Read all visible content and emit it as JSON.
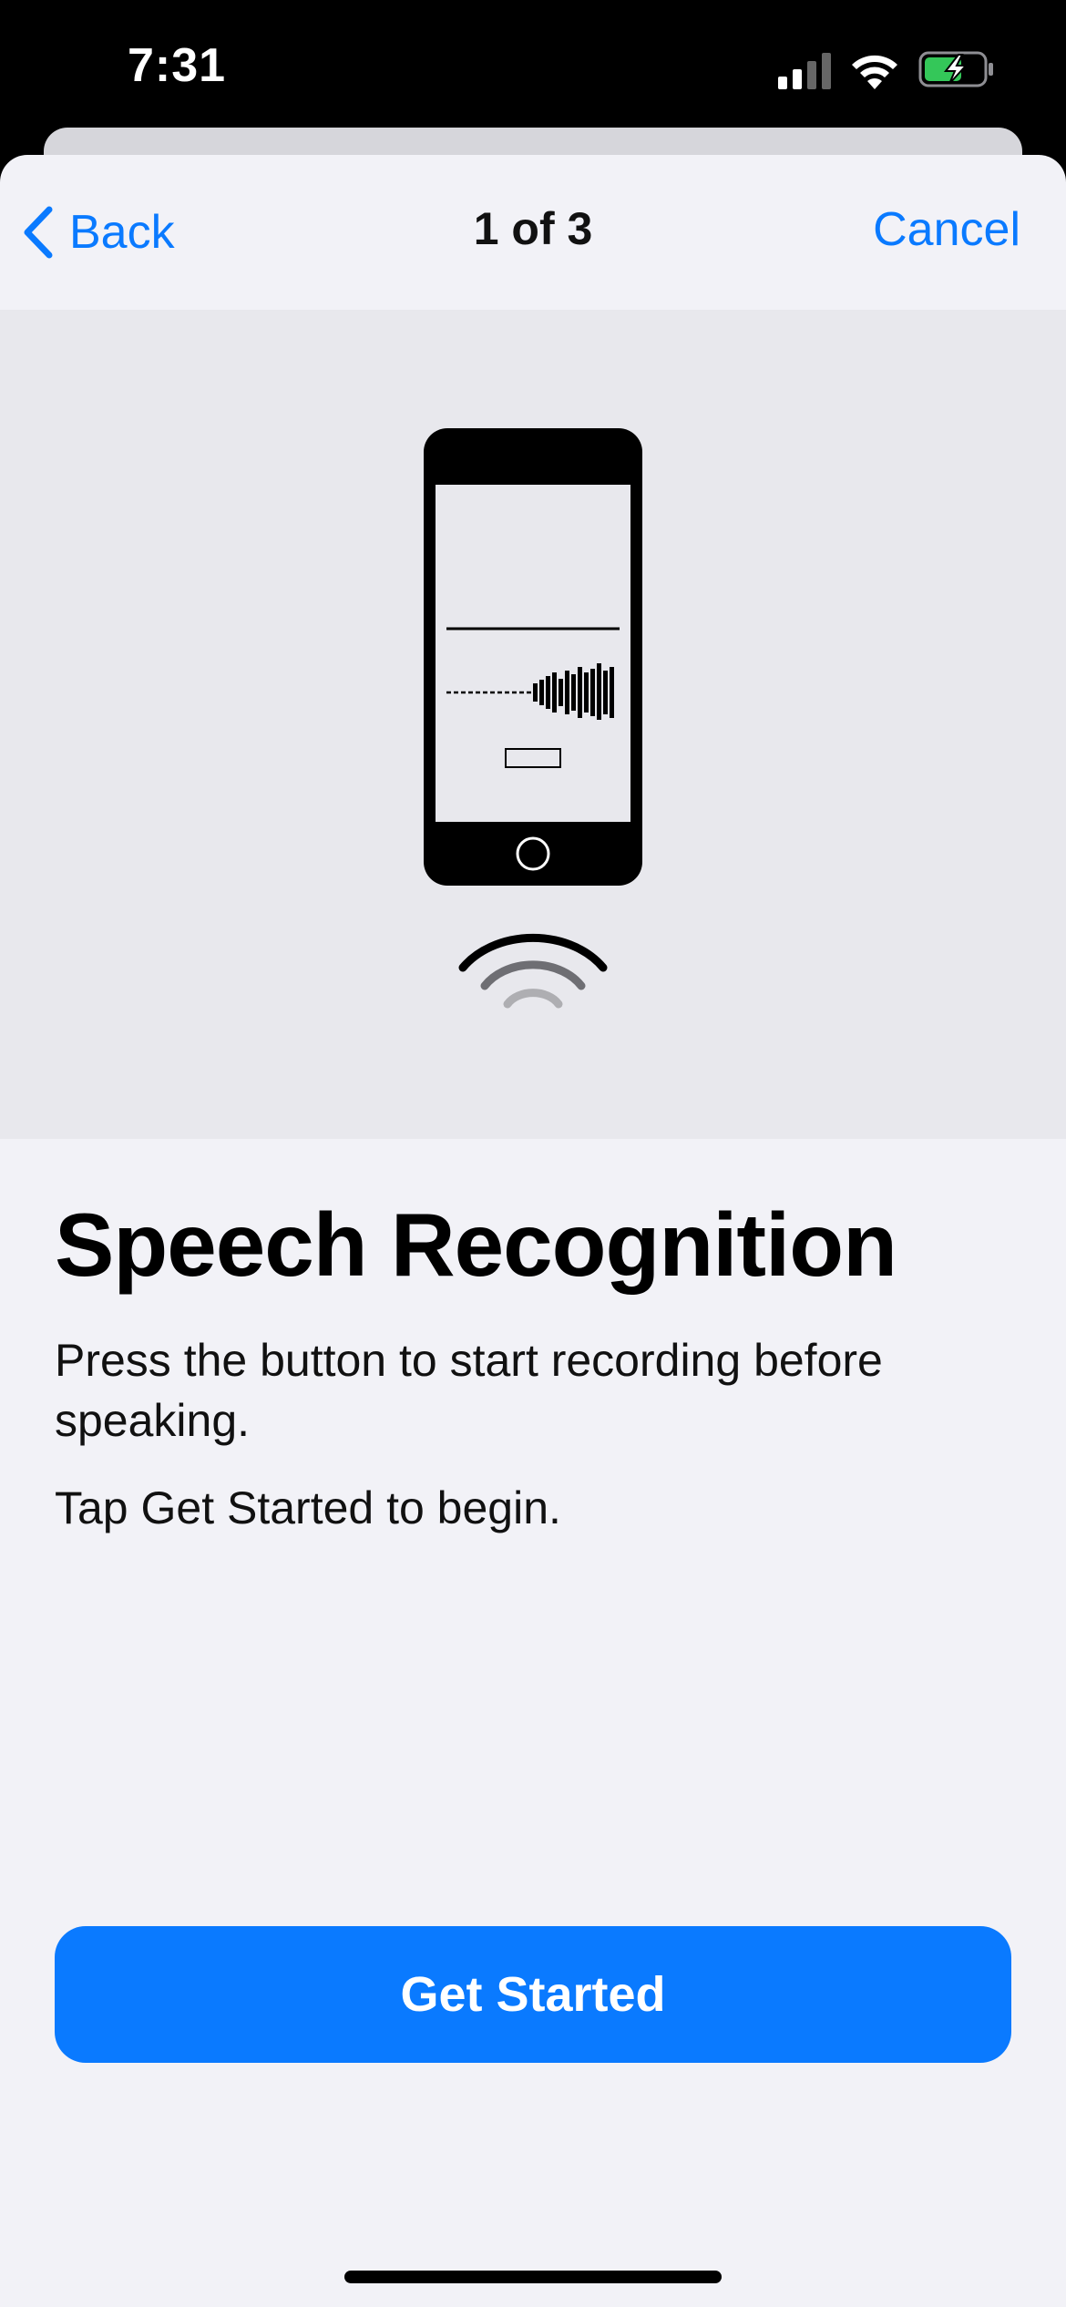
{
  "status_bar": {
    "time": "7:31",
    "icons": [
      "signal-icon",
      "wifi-icon",
      "battery-charging-icon"
    ]
  },
  "nav": {
    "back_label": "Back",
    "title": "1 of 3",
    "cancel_label": "Cancel"
  },
  "illustration": {
    "icon": "phone-recording-illustration"
  },
  "content": {
    "heading": "Speech Recognition",
    "paragraph_1": "Press the button to start recording before speaking.",
    "paragraph_2": "Tap Get Started to begin."
  },
  "actions": {
    "primary_label": "Get Started"
  },
  "colors": {
    "accent": "#0a7aff",
    "sheet_background": "#f2f2f7",
    "illustration_background": "#e8e8ed"
  }
}
